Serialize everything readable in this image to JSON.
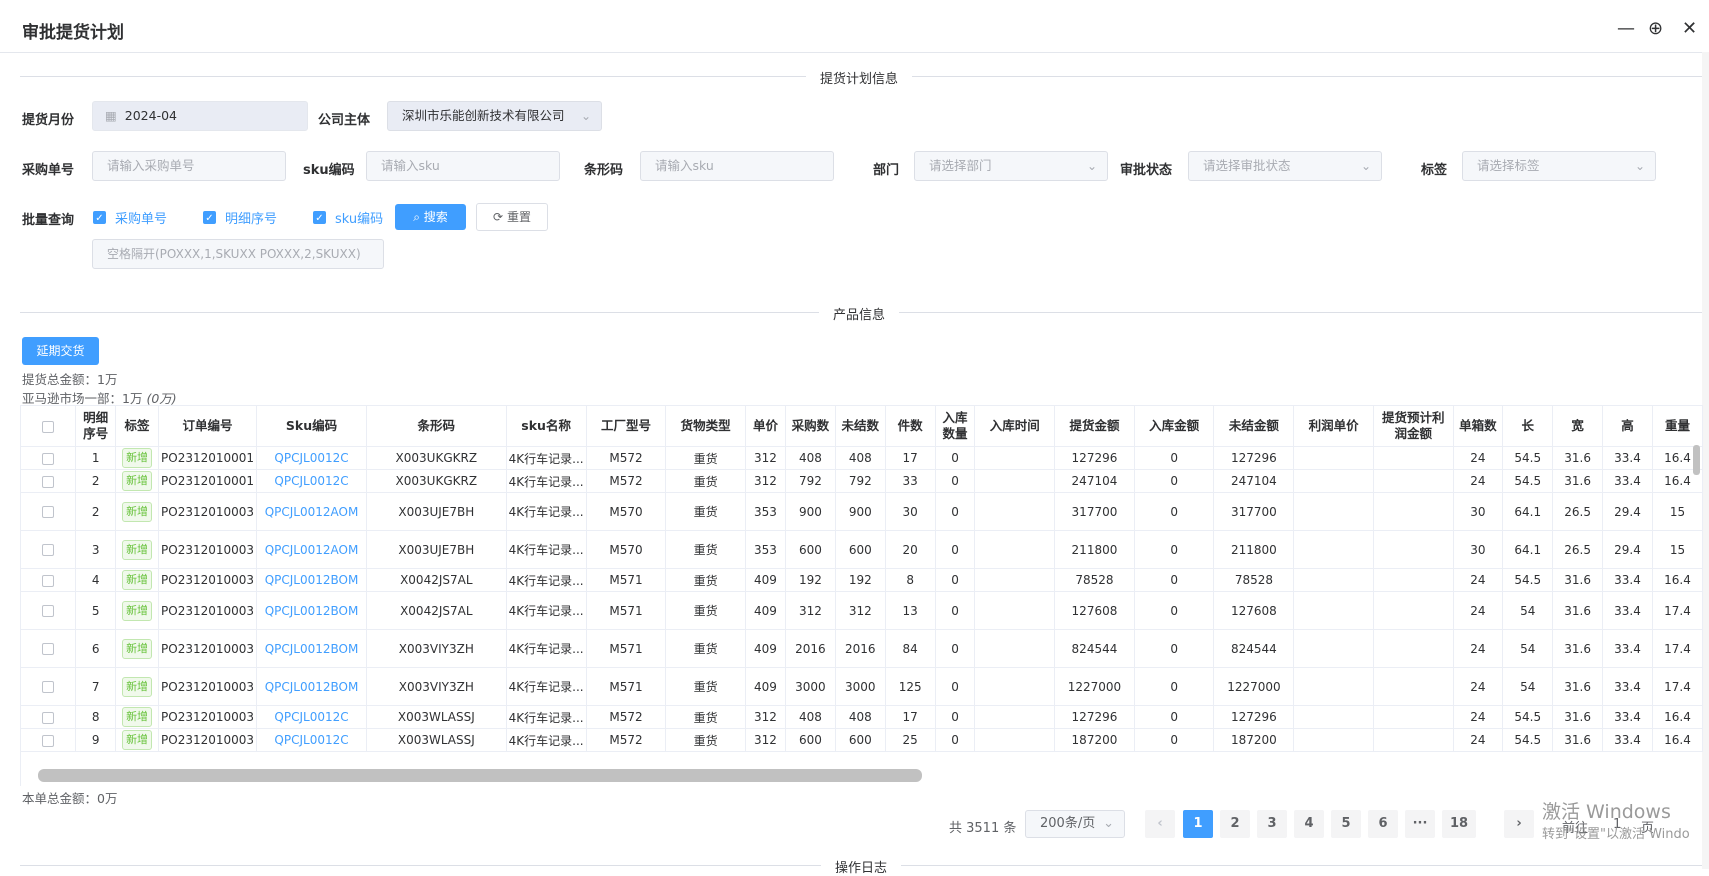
{
  "dialog": {
    "title": "审批提货计划",
    "controls": {
      "minimize": "—",
      "zoom": "⊕",
      "close": "✕"
    }
  },
  "sections": {
    "plan_info": "提货计划信息",
    "product_info": "产品信息",
    "operation_log": "操作日志"
  },
  "form": {
    "month_label": "提货月份",
    "month_value": "2024-04",
    "company_label": "公司主体",
    "company_value": "深圳市乐能创新技术有限公司",
    "po_label": "采购单号",
    "po_placeholder": "请输入采购单号",
    "sku_label": "sku编码",
    "sku_placeholder": "请输入sku",
    "barcode_label": "条形码",
    "barcode_placeholder": "请输入sku",
    "dept_label": "部门",
    "dept_placeholder": "请选择部门",
    "status_label": "审批状态",
    "status_placeholder": "请选择审批状态",
    "tag_label": "标签",
    "tag_placeholder": "请选择标签",
    "batch_label": "批量查询",
    "batch_opts": [
      "采购单号",
      "明细序号",
      "sku编码"
    ],
    "search_btn": "搜索",
    "reset_btn": "重置",
    "batch_placeholder": "空格隔开(POXXX,1,SKUXX  POXXX,2,SKUXX)"
  },
  "actions": {
    "extend_btn": "延期交货"
  },
  "summary": {
    "total": "提货总金额：1万",
    "market_prefix": "亚马逊市场一部：1万",
    "market_suffix": "(0万)",
    "order_total": "本单总金额：0万"
  },
  "table": {
    "headers": [
      "",
      "明细\n序号",
      "标签",
      "订单编号",
      "Sku编码",
      "条形码",
      "sku名称",
      "工厂型号",
      "货物类型",
      "单价",
      "采购数",
      "未结数",
      "件数",
      "入库\n数量",
      "入库时间",
      "提货金额",
      "入库金额",
      "未结金额",
      "利润单价",
      "提货预计利\n润金额",
      "单箱数",
      "长",
      "宽",
      "高",
      "重量"
    ],
    "rows": [
      {
        "no": "1",
        "tag": "新增",
        "order": "PO2312010001",
        "sku": "QPCJL0012C",
        "barcode": "X003UKGKRZ",
        "name": "4K行车记录...",
        "model": "M572",
        "type": "重货",
        "price": "312",
        "qty": "408",
        "open": "408",
        "pcs": "17",
        "in": "0",
        "in_time": "",
        "amount": "127296",
        "in_amt": "0",
        "open_amt": "127296",
        "profit_u": "",
        "profit": "",
        "box": "24",
        "l": "54.5",
        "w": "31.6",
        "h": "33.4",
        "wt": "16.4"
      },
      {
        "no": "2",
        "tag": "新增",
        "order": "PO2312010001",
        "sku": "QPCJL0012C",
        "barcode": "X003UKGKRZ",
        "name": "4K行车记录...",
        "model": "M572",
        "type": "重货",
        "price": "312",
        "qty": "792",
        "open": "792",
        "pcs": "33",
        "in": "0",
        "in_time": "",
        "amount": "247104",
        "in_amt": "0",
        "open_amt": "247104",
        "profit_u": "",
        "profit": "",
        "box": "24",
        "l": "54.5",
        "w": "31.6",
        "h": "33.4",
        "wt": "16.4"
      },
      {
        "no": "2",
        "tag": "新增",
        "order": "PO2312010003",
        "sku": "QPCJL0012AOM",
        "barcode": "X003UJE7BH",
        "name": "4K行车记录...",
        "model": "M570",
        "type": "重货",
        "price": "353",
        "qty": "900",
        "open": "900",
        "pcs": "30",
        "in": "0",
        "in_time": "",
        "amount": "317700",
        "in_amt": "0",
        "open_amt": "317700",
        "profit_u": "",
        "profit": "",
        "box": "30",
        "l": "64.1",
        "w": "26.5",
        "h": "29.4",
        "wt": "15"
      },
      {
        "no": "3",
        "tag": "新增",
        "order": "PO2312010003",
        "sku": "QPCJL0012AOM",
        "barcode": "X003UJE7BH",
        "name": "4K行车记录...",
        "model": "M570",
        "type": "重货",
        "price": "353",
        "qty": "600",
        "open": "600",
        "pcs": "20",
        "in": "0",
        "in_time": "",
        "amount": "211800",
        "in_amt": "0",
        "open_amt": "211800",
        "profit_u": "",
        "profit": "",
        "box": "30",
        "l": "64.1",
        "w": "26.5",
        "h": "29.4",
        "wt": "15"
      },
      {
        "no": "4",
        "tag": "新增",
        "order": "PO2312010003",
        "sku": "QPCJL0012BOM",
        "barcode": "X0042JS7AL",
        "name": "4K行车记录...",
        "model": "M571",
        "type": "重货",
        "price": "409",
        "qty": "192",
        "open": "192",
        "pcs": "8",
        "in": "0",
        "in_time": "",
        "amount": "78528",
        "in_amt": "0",
        "open_amt": "78528",
        "profit_u": "",
        "profit": "",
        "box": "24",
        "l": "54.5",
        "w": "31.6",
        "h": "33.4",
        "wt": "16.4"
      },
      {
        "no": "5",
        "tag": "新增",
        "order": "PO2312010003",
        "sku": "QPCJL0012BOM",
        "barcode": "X0042JS7AL",
        "name": "4K行车记录...",
        "model": "M571",
        "type": "重货",
        "price": "409",
        "qty": "312",
        "open": "312",
        "pcs": "13",
        "in": "0",
        "in_time": "",
        "amount": "127608",
        "in_amt": "0",
        "open_amt": "127608",
        "profit_u": "",
        "profit": "",
        "box": "24",
        "l": "54",
        "w": "31.6",
        "h": "33.4",
        "wt": "17.4"
      },
      {
        "no": "6",
        "tag": "新增",
        "order": "PO2312010003",
        "sku": "QPCJL0012BOM",
        "barcode": "X003VIY3ZH",
        "name": "4K行车记录...",
        "model": "M571",
        "type": "重货",
        "price": "409",
        "qty": "2016",
        "open": "2016",
        "pcs": "84",
        "in": "0",
        "in_time": "",
        "amount": "824544",
        "in_amt": "0",
        "open_amt": "824544",
        "profit_u": "",
        "profit": "",
        "box": "24",
        "l": "54",
        "w": "31.6",
        "h": "33.4",
        "wt": "17.4"
      },
      {
        "no": "7",
        "tag": "新增",
        "order": "PO2312010003",
        "sku": "QPCJL0012BOM",
        "barcode": "X003VIY3ZH",
        "name": "4K行车记录...",
        "model": "M571",
        "type": "重货",
        "price": "409",
        "qty": "3000",
        "open": "3000",
        "pcs": "125",
        "in": "0",
        "in_time": "",
        "amount": "1227000",
        "in_amt": "0",
        "open_amt": "1227000",
        "profit_u": "",
        "profit": "",
        "box": "24",
        "l": "54",
        "w": "31.6",
        "h": "33.4",
        "wt": "17.4"
      },
      {
        "no": "8",
        "tag": "新增",
        "order": "PO2312010003",
        "sku": "QPCJL0012C",
        "barcode": "X003WLASSJ",
        "name": "4K行车记录...",
        "model": "M572",
        "type": "重货",
        "price": "312",
        "qty": "408",
        "open": "408",
        "pcs": "17",
        "in": "0",
        "in_time": "",
        "amount": "127296",
        "in_amt": "0",
        "open_amt": "127296",
        "profit_u": "",
        "profit": "",
        "box": "24",
        "l": "54.5",
        "w": "31.6",
        "h": "33.4",
        "wt": "16.4"
      },
      {
        "no": "9",
        "tag": "新增",
        "order": "PO2312010003",
        "sku": "QPCJL0012C",
        "barcode": "X003WLASSJ",
        "name": "4K行车记录...",
        "model": "M572",
        "type": "重货",
        "price": "312",
        "qty": "600",
        "open": "600",
        "pcs": "25",
        "in": "0",
        "in_time": "",
        "amount": "187200",
        "in_amt": "0",
        "open_amt": "187200",
        "profit_u": "",
        "profit": "",
        "box": "24",
        "l": "54.5",
        "w": "31.6",
        "h": "33.4",
        "wt": "16.4"
      }
    ]
  },
  "pagination": {
    "total": "共 3511 条",
    "page_size": "200条/页",
    "prev": "‹",
    "next": "›",
    "pages": [
      "1",
      "2",
      "3",
      "4",
      "5",
      "6",
      "···",
      "18"
    ],
    "goto_label": "前往",
    "goto_value": "1",
    "page_suffix": "页"
  },
  "watermark": {
    "line1": "激活 Windows",
    "line2": "转到\"设置\"以激活 Windo"
  },
  "colors": {
    "primary": "#409eff",
    "tag_green": "#67c23a"
  }
}
